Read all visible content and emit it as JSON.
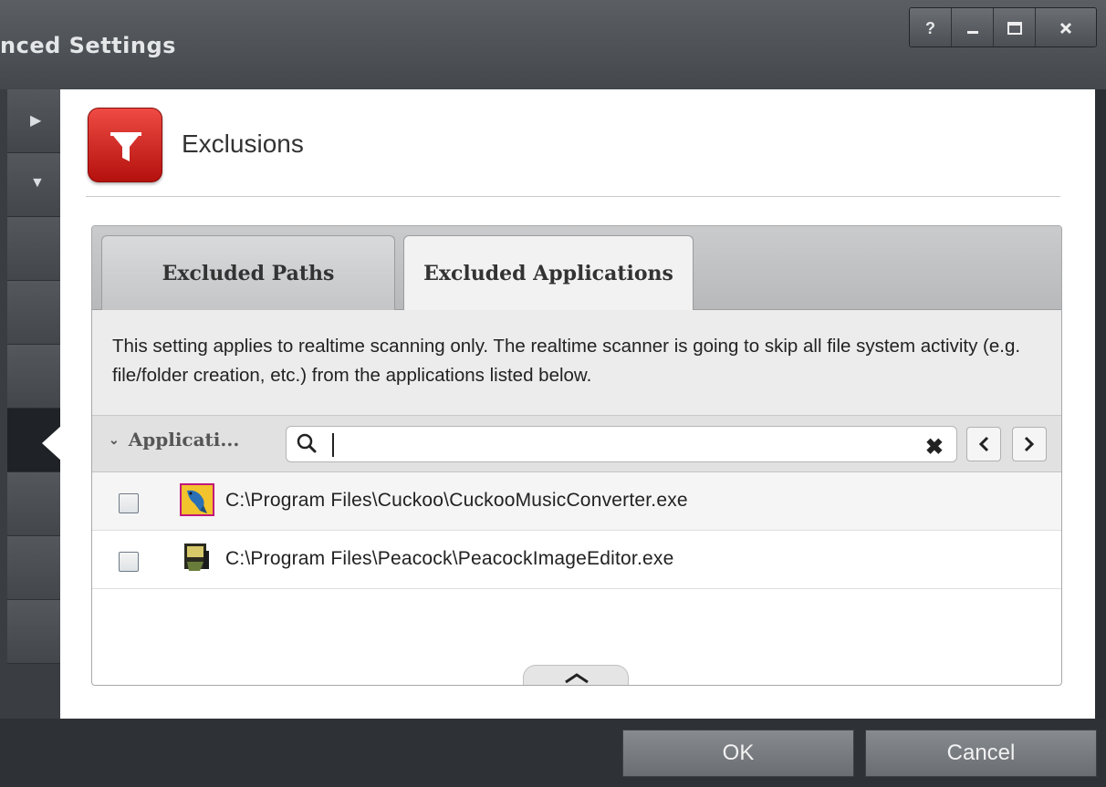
{
  "window": {
    "title": "nced Settings",
    "controls": {
      "help": "?",
      "minimize": "_",
      "maximize": "☐",
      "close": "×"
    }
  },
  "header": {
    "title": "Exclusions",
    "icon": "funnel-icon",
    "accent": "#d41f1b"
  },
  "tabs": [
    {
      "label": "Excluded Paths",
      "active": false
    },
    {
      "label": "Excluded Applications",
      "active": true
    }
  ],
  "description": "This setting applies to realtime scanning only. The realtime scanner is going to skip all file system activity (e.g. file/folder creation, etc.) from the applications listed below.",
  "filter": {
    "column_label": "Applicati...",
    "search_value": "",
    "search_placeholder": ""
  },
  "applications": [
    {
      "path": "C:\\Program Files\\Cuckoo\\CuckooMusicConverter.exe",
      "checked": false,
      "icon": "cuckoo-app-icon"
    },
    {
      "path": "C:\\Program Files\\Peacock\\PeacockImageEditor.exe",
      "checked": false,
      "icon": "peacock-app-icon"
    }
  ],
  "footer": {
    "ok_label": "OK",
    "cancel_label": "Cancel"
  }
}
